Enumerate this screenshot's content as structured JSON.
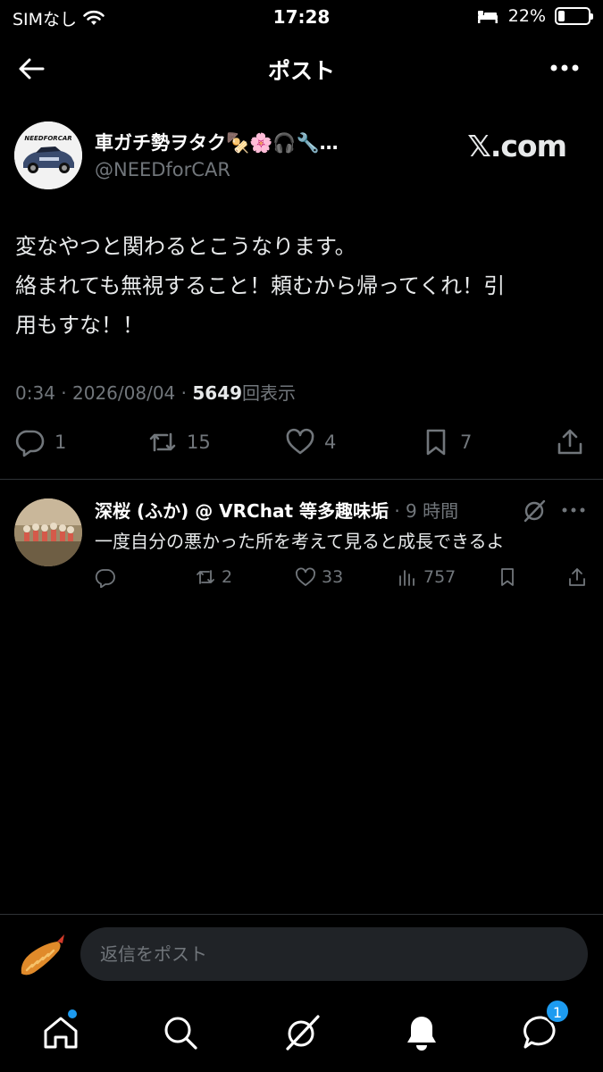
{
  "status_bar": {
    "carrier": "SIMなし",
    "time": "17:28",
    "battery": "22%",
    "battery_level": 0.22
  },
  "header": {
    "title": "ポスト"
  },
  "post": {
    "author_name": "車ガチ勢ヲタク🍢🌸🎧🔧…",
    "handle": "@NEEDforCAR",
    "source_logo": "𝕏.com",
    "avatar_text": "NEEDFORCAR",
    "text_lines": [
      "変なやつと関わるとこうなります。",
      "絡まれても無視すること！頼むから帰ってくれ！引",
      "用もすな！！"
    ],
    "time": "0:34",
    "date": "2026/08/04",
    "views_count": "5649",
    "views_label": "回表示",
    "actions": {
      "replies": "1",
      "reposts": "15",
      "likes": "4",
      "bookmarks": "7"
    }
  },
  "reply": {
    "author_name": "深桜 (ふか) @ VRChat 等多趣味垢",
    "time": "· 9 時間",
    "text": "一度自分の悪かった所を考えて見ると成長できるよ",
    "actions": {
      "replies": "",
      "reposts": "2",
      "likes": "33",
      "views": "757"
    }
  },
  "compose": {
    "placeholder": "返信をポスト"
  },
  "tab_bar": {
    "messages_badge": "1"
  },
  "colors": {
    "background": "#000000",
    "text": "#e7e9ea",
    "muted": "#71767b",
    "accent": "#1d9bf0",
    "divider": "#2f3336"
  }
}
